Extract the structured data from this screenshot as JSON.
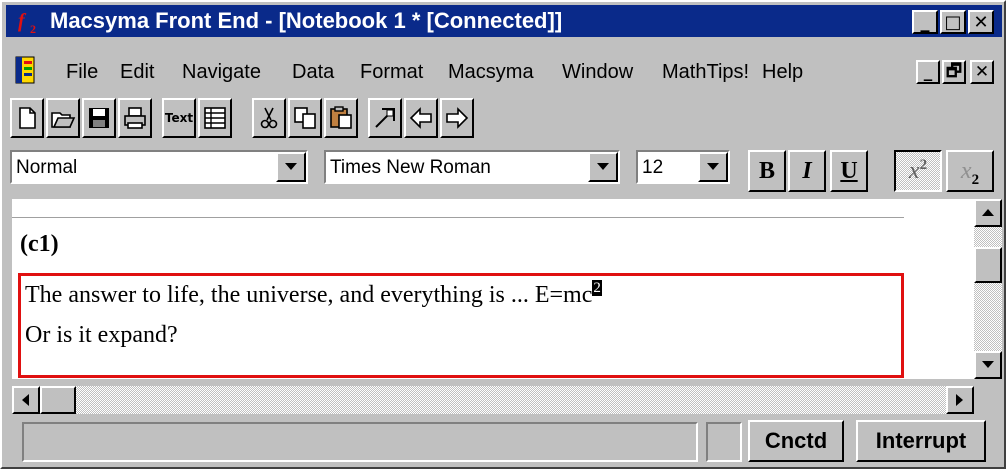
{
  "window": {
    "title": "Macsyma Front End - [Notebook 1 * [Connected]]",
    "app_icon": "macsyma-f2-icon",
    "controls": [
      "_",
      "□",
      "✕"
    ]
  },
  "menu": {
    "items": [
      "File",
      "Edit",
      "Navigate",
      "Data",
      "Format",
      "Macsyma",
      "Window",
      "MathTips!",
      "Help"
    ],
    "mdi_controls": [
      "_",
      "🗗",
      "✕"
    ]
  },
  "toolbar": {
    "buttons": [
      "new-icon",
      "open-icon",
      "save-icon",
      "print-icon",
      "text-icon",
      "table-icon",
      "cut-icon",
      "copy-icon",
      "paste-icon",
      "jump-icon",
      "back-icon",
      "forward-icon"
    ],
    "text_label": "Text"
  },
  "format": {
    "style": "Normal",
    "font": "Times New Roman",
    "size": "12",
    "bold": "B",
    "italic": "I",
    "underline": "U",
    "superscript": "x",
    "superscript_exp": "2",
    "subscript": "x",
    "subscript_exp": "2"
  },
  "document": {
    "cell_label": "(c1)",
    "line1": "The answer to life, the universe, and everything is ... E=mc",
    "line1_sup": "2",
    "line2": "Or is it expand?"
  },
  "status": {
    "connection": "Cnctd",
    "interrupt": "Interrupt"
  }
}
